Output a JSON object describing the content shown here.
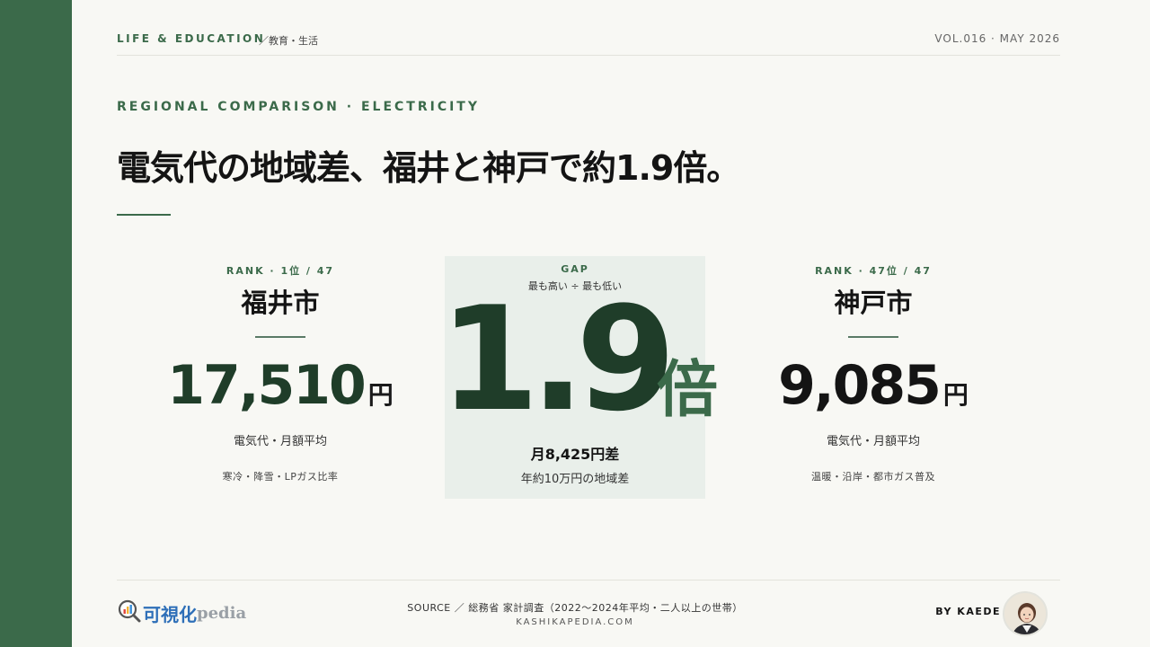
{
  "header": {
    "category_en": "LIFE & EDUCATION",
    "category_ja": "／教育・生活",
    "volume": "VOL.016 · MAY 2026"
  },
  "kicker": "REGIONAL COMPARISON · ELECTRICITY",
  "headline": "電気代の地域差、福井と神戸で約1.9倍。",
  "left_city": {
    "rank": "RANK · 1位 / 47",
    "name": "福井市",
    "amount": "17,510",
    "unit": "円",
    "metric": "電気代・月額平均",
    "factors": "寒冷・降雪・LPガス比率"
  },
  "gap": {
    "label": "GAP",
    "sublabel": "最も高い ÷ 最も低い",
    "ratio": "1.9",
    "ratio_unit": "倍",
    "monthly_diff": "月8,425円差",
    "annual_diff": "年約10万円の地域差"
  },
  "right_city": {
    "rank": "RANK · 47位 / 47",
    "name": "神戸市",
    "amount": "9,085",
    "unit": "円",
    "metric": "電気代・月額平均",
    "factors": "温暖・沿岸・都市ガス普及"
  },
  "footer": {
    "logo_ja": "可視化",
    "logo_en": "pedia",
    "source": "SOURCE ／ 総務省 家計調査（2022〜2024年平均・二人以上の世帯）",
    "site": "KASHIKAPEDIA.COM",
    "byline": "BY KAEDE"
  },
  "colors": {
    "accent": "#3b6a4a",
    "dark_green": "#1f3d29",
    "background": "#f8f8f4",
    "gap_box": "#e9efea",
    "logo_blue": "#2e6fb8"
  },
  "icons": {
    "logo_mark": "magnifier-chart-icon",
    "avatar": "author-avatar"
  }
}
